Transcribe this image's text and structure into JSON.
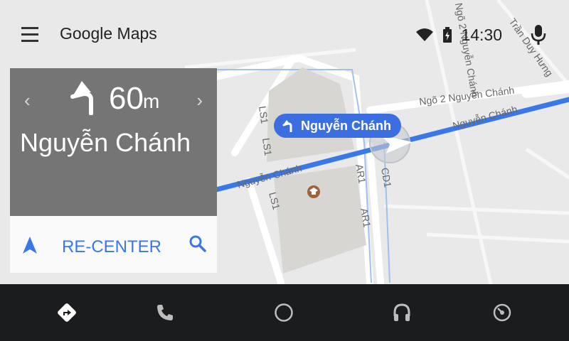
{
  "app": {
    "title": "Google Maps"
  },
  "status": {
    "time": "14:30"
  },
  "navigation": {
    "distance": "60",
    "unit": "m",
    "street": "Nguyễn Chánh",
    "prev": "‹",
    "next": "›",
    "recenter_label": "RE-CENTER"
  },
  "current_street_pill": "Nguyễn Chánh",
  "map": {
    "labels": [
      {
        "text": "Ngõ 2 Nguyễn Chánh"
      },
      {
        "text": "Nguyễn Chánh"
      },
      {
        "text": "Nguyễn Chánh"
      },
      {
        "text": "LS1"
      },
      {
        "text": "LS1"
      },
      {
        "text": "LS1"
      },
      {
        "text": "AR1"
      },
      {
        "text": "AR1"
      },
      {
        "text": "CD1"
      },
      {
        "text": "Trần Duy Hưng"
      },
      {
        "text": "Ngõ 2 Nguyễn Chánh"
      }
    ]
  },
  "bottom_nav": [
    "navigation-icon",
    "phone-icon",
    "home-icon",
    "headphones-icon",
    "car-icon"
  ],
  "colors": {
    "route": "#3b78e7",
    "nav_card": "#757575",
    "bottom_bar": "#1b1c1e",
    "accent": "#3b78e7"
  }
}
